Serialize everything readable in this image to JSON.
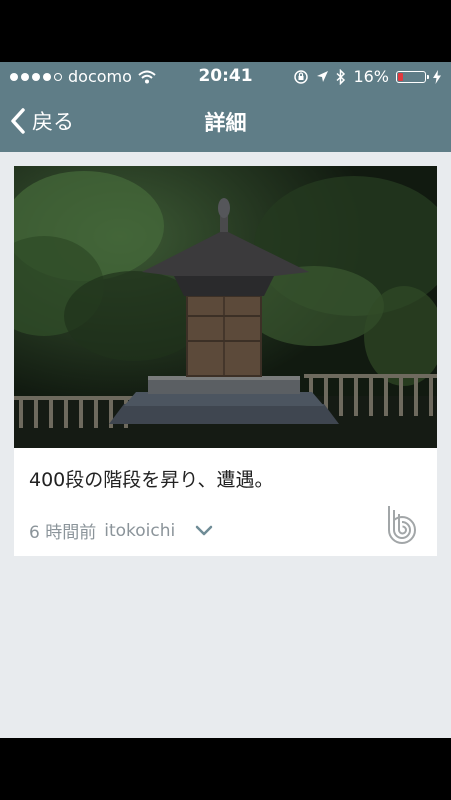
{
  "status_bar": {
    "carrier": "docomo",
    "time": "20:41",
    "battery_percent": "16%",
    "signal_bars_filled": 4,
    "signal_bars_total": 5
  },
  "nav": {
    "back_label": "戻る",
    "title": "詳細"
  },
  "post": {
    "caption": "400段の階段を昇り、遭遇。",
    "time_ago": "6 時間前",
    "author": "itokoichi"
  },
  "colors": {
    "header": "#5f7d87",
    "background": "#e8ebee",
    "battery_low": "#e0383e"
  },
  "icons": [
    "wifi-icon",
    "rotation-lock-icon",
    "location-arrow-icon",
    "bluetooth-icon",
    "battery-icon",
    "charging-bolt-icon",
    "back-chevron-icon",
    "chevron-down-icon",
    "app-logo-icon"
  ]
}
